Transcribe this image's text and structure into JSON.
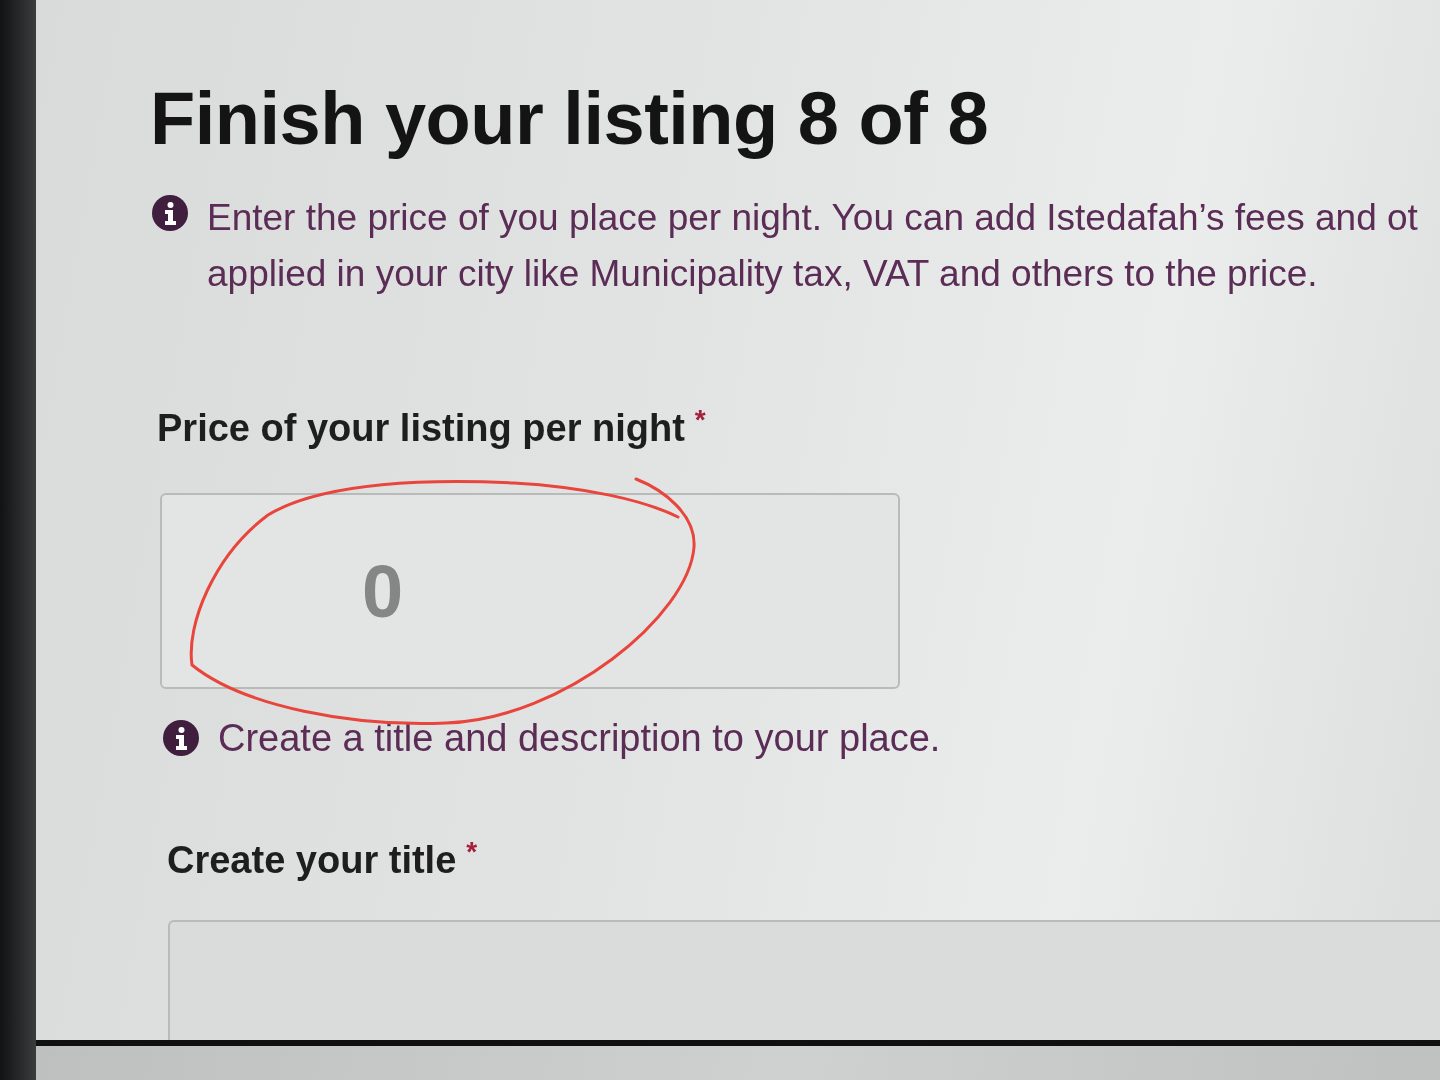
{
  "heading": "Finish your listing 8 of 8",
  "price_hint": {
    "lines": [
      "Enter the price of you place per night. You can add Istedafah’s fees and ot",
      "applied in your city like Municipality tax, VAT and others to the price."
    ]
  },
  "price_field": {
    "label": "Price of your listing per night",
    "required_mark": "*",
    "placeholder": "0"
  },
  "title_hint": {
    "lines": [
      "Create a title and description to your place."
    ]
  },
  "title_field": {
    "label": "Create your title",
    "required_mark": "*"
  }
}
